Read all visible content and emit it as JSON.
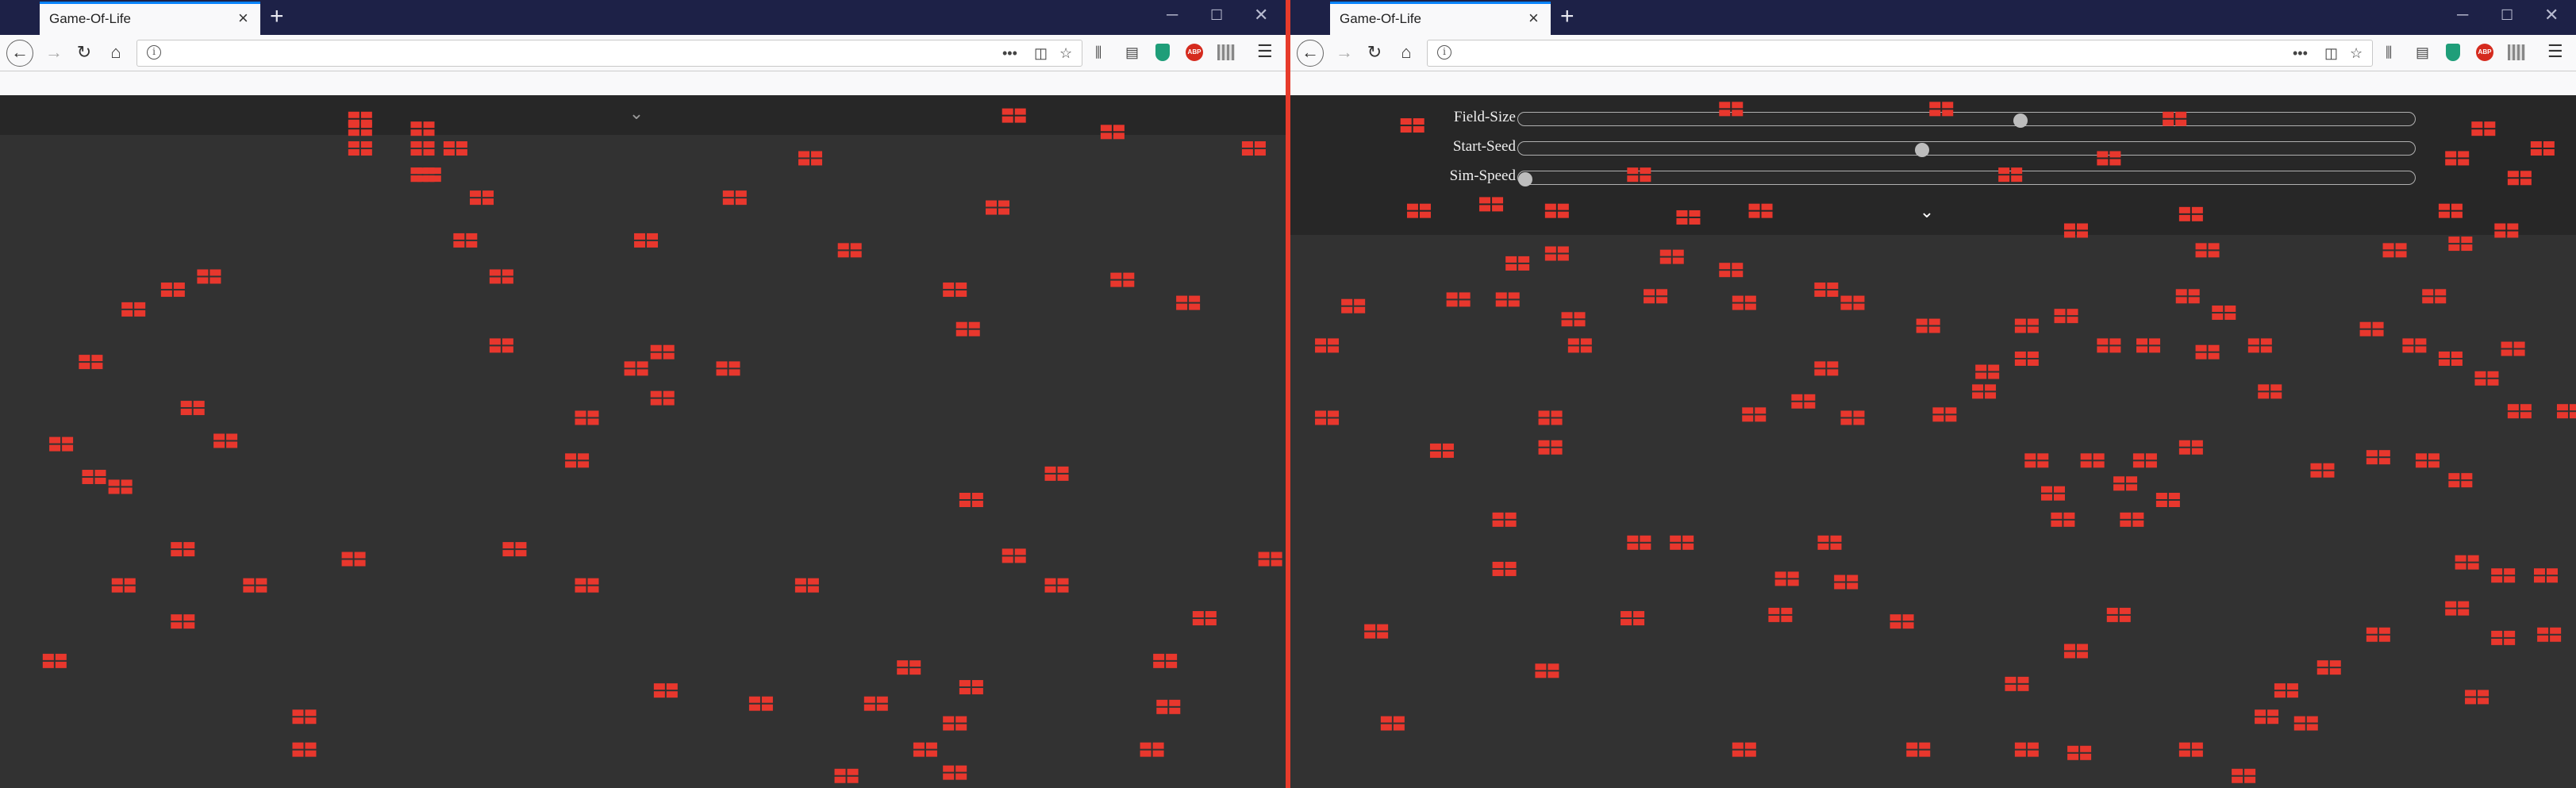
{
  "browser": {
    "tab_title": "Game-Of-Life",
    "tab_close": "×",
    "new_tab": "+",
    "window_controls": {
      "minimize": "─",
      "maximize": "☐",
      "close": "✕"
    }
  },
  "controls": {
    "expand_icon": "chevron-down-icon",
    "sliders": [
      {
        "label": "Field-Size",
        "value_fraction": 0.56
      },
      {
        "label": "Start-Seed",
        "value_fraction": 0.45
      },
      {
        "label": "Sim-Speed",
        "value_fraction": 0.0
      }
    ]
  },
  "colors": {
    "cell": "#e8372d",
    "background": "#323232",
    "panel": "#272727",
    "accent_tab": "#0a84ff"
  },
  "left_cells": [
    [
      212,
      68
    ],
    [
      212,
      74
    ],
    [
      250,
      74
    ],
    [
      250,
      86
    ],
    [
      250,
      102
    ],
    [
      212,
      86
    ],
    [
      270,
      86
    ],
    [
      250,
      102
    ],
    [
      286,
      116
    ],
    [
      276,
      142
    ],
    [
      254,
      102
    ],
    [
      120,
      164
    ],
    [
      98,
      172
    ],
    [
      74,
      184
    ],
    [
      48,
      216
    ],
    [
      110,
      244
    ],
    [
      130,
      264
    ],
    [
      30,
      266
    ],
    [
      50,
      286
    ],
    [
      66,
      292
    ],
    [
      298,
      164
    ],
    [
      298,
      206
    ],
    [
      386,
      142
    ],
    [
      486,
      92
    ],
    [
      440,
      116
    ],
    [
      510,
      148
    ],
    [
      396,
      210
    ],
    [
      380,
      220
    ],
    [
      436,
      220
    ],
    [
      396,
      238
    ],
    [
      600,
      122
    ],
    [
      574,
      172
    ],
    [
      582,
      196
    ],
    [
      670,
      76
    ],
    [
      610,
      66
    ],
    [
      756,
      86
    ],
    [
      676,
      166
    ],
    [
      716,
      180
    ],
    [
      350,
      250
    ],
    [
      344,
      276
    ],
    [
      584,
      300
    ],
    [
      636,
      284
    ],
    [
      610,
      334
    ],
    [
      636,
      352
    ],
    [
      766,
      336
    ],
    [
      104,
      330
    ],
    [
      68,
      352
    ],
    [
      148,
      352
    ],
    [
      104,
      374
    ],
    [
      26,
      398
    ],
    [
      306,
      330
    ],
    [
      208,
      336
    ],
    [
      350,
      352
    ],
    [
      484,
      352
    ],
    [
      726,
      372
    ],
    [
      702,
      398
    ],
    [
      546,
      402
    ],
    [
      584,
      414
    ],
    [
      398,
      416
    ],
    [
      456,
      424
    ],
    [
      526,
      424
    ],
    [
      704,
      426
    ],
    [
      178,
      432
    ],
    [
      178,
      452
    ],
    [
      574,
      436
    ],
    [
      556,
      452
    ],
    [
      694,
      452
    ],
    [
      508,
      468
    ],
    [
      574,
      466
    ]
  ],
  "right_cells": [
    [
      852,
      72
    ],
    [
      1046,
      62
    ],
    [
      1174,
      62
    ],
    [
      1316,
      68
    ],
    [
      1504,
      74
    ],
    [
      1540,
      86
    ],
    [
      1488,
      92
    ],
    [
      1526,
      104
    ],
    [
      990,
      102
    ],
    [
      1216,
      102
    ],
    [
      1276,
      92
    ],
    [
      856,
      124
    ],
    [
      900,
      120
    ],
    [
      940,
      124
    ],
    [
      1020,
      128
    ],
    [
      1064,
      124
    ],
    [
      1326,
      126
    ],
    [
      1484,
      124
    ],
    [
      1518,
      136
    ],
    [
      1256,
      136
    ],
    [
      1336,
      148
    ],
    [
      1450,
      148
    ],
    [
      1490,
      144
    ],
    [
      940,
      150
    ],
    [
      1010,
      152
    ],
    [
      1046,
      160
    ],
    [
      916,
      156
    ],
    [
      880,
      178
    ],
    [
      910,
      178
    ],
    [
      950,
      190
    ],
    [
      1000,
      176
    ],
    [
      1054,
      180
    ],
    [
      1104,
      172
    ],
    [
      1120,
      180
    ],
    [
      1166,
      194
    ],
    [
      1226,
      194
    ],
    [
      1250,
      188
    ],
    [
      1276,
      206
    ],
    [
      1300,
      206
    ],
    [
      1324,
      176
    ],
    [
      1346,
      186
    ],
    [
      1368,
      206
    ],
    [
      1436,
      196
    ],
    [
      1462,
      206
    ],
    [
      1474,
      176
    ],
    [
      1796,
      178
    ],
    [
      1522,
      208
    ],
    [
      816,
      182
    ],
    [
      800,
      206
    ],
    [
      954,
      206
    ],
    [
      1104,
      220
    ],
    [
      1090,
      240
    ],
    [
      1120,
      250
    ],
    [
      1060,
      248
    ],
    [
      1176,
      248
    ],
    [
      1202,
      222
    ],
    [
      1226,
      214
    ],
    [
      1200,
      234
    ],
    [
      1336,
      210
    ],
    [
      1374,
      234
    ],
    [
      1484,
      214
    ],
    [
      1506,
      226
    ],
    [
      1526,
      246
    ],
    [
      1556,
      246
    ],
    [
      800,
      250
    ],
    [
      870,
      270
    ],
    [
      936,
      250
    ],
    [
      936,
      268
    ],
    [
      1232,
      276
    ],
    [
      1266,
      276
    ],
    [
      1298,
      276
    ],
    [
      1326,
      268
    ],
    [
      1242,
      296
    ],
    [
      1286,
      290
    ],
    [
      1312,
      300
    ],
    [
      1248,
      312
    ],
    [
      1290,
      312
    ],
    [
      1406,
      282
    ],
    [
      1440,
      274
    ],
    [
      1470,
      276
    ],
    [
      1490,
      288
    ],
    [
      908,
      312
    ],
    [
      908,
      342
    ],
    [
      990,
      326
    ],
    [
      1016,
      326
    ],
    [
      1106,
      326
    ],
    [
      1080,
      348
    ],
    [
      1116,
      350
    ],
    [
      1076,
      370
    ],
    [
      1150,
      374
    ],
    [
      986,
      372
    ],
    [
      1282,
      370
    ],
    [
      1256,
      392
    ],
    [
      830,
      380
    ],
    [
      934,
      404
    ],
    [
      1220,
      412
    ],
    [
      1384,
      416
    ],
    [
      1410,
      402
    ],
    [
      1440,
      382
    ],
    [
      1494,
      338
    ],
    [
      1516,
      346
    ],
    [
      1542,
      346
    ],
    [
      1488,
      366
    ],
    [
      1516,
      384
    ],
    [
      1544,
      382
    ],
    [
      1500,
      420
    ],
    [
      1396,
      436
    ],
    [
      1372,
      432
    ],
    [
      840,
      436
    ],
    [
      1054,
      452
    ],
    [
      1160,
      452
    ],
    [
      1226,
      452
    ],
    [
      1258,
      454
    ],
    [
      1326,
      452
    ],
    [
      1358,
      468
    ]
  ]
}
